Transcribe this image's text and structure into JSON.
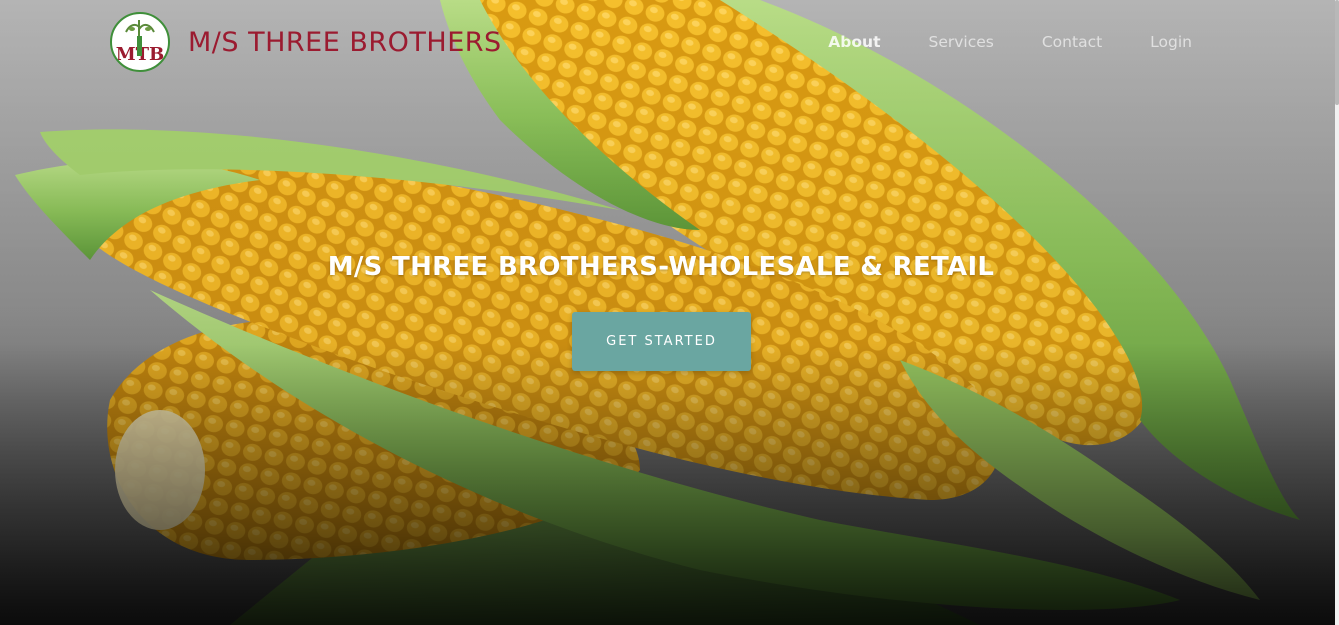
{
  "brand": {
    "name": "M/S THREE BROTHERS",
    "logo_text": "MTB"
  },
  "nav": {
    "items": [
      {
        "label": "About",
        "active": true
      },
      {
        "label": "Services",
        "active": false
      },
      {
        "label": "Contact",
        "active": false
      },
      {
        "label": "Login",
        "active": false
      }
    ]
  },
  "hero": {
    "title": "M/S THREE BROTHERS-WHOLESALE & RETAIL",
    "cta_label": "GET STARTED",
    "background_image": "corn-cobs-with-husks"
  },
  "colors": {
    "brand_text": "#9b1b30",
    "cta_bg": "#6aa6a1",
    "corn_kernel": "#f2b41e",
    "husk_green": "#8cc15a"
  }
}
